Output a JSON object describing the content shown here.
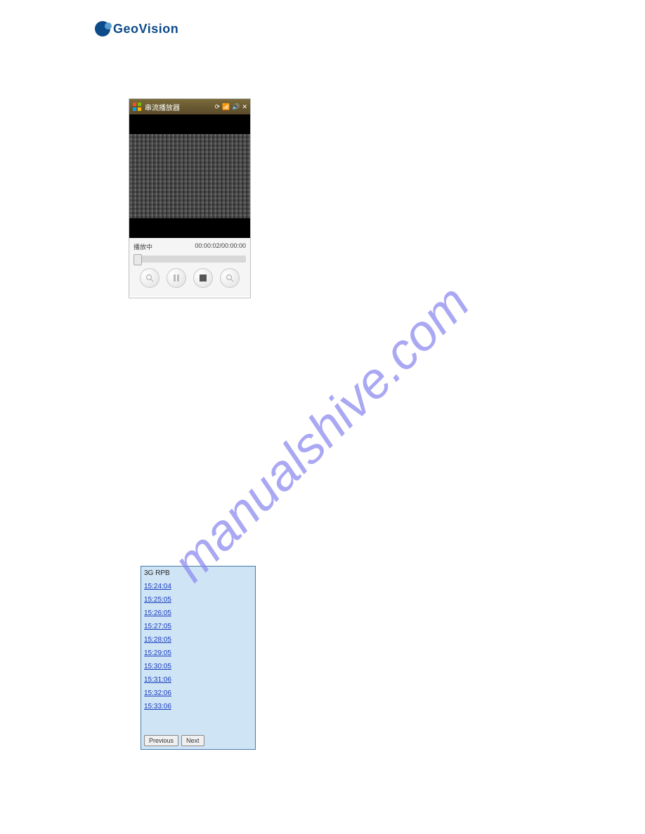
{
  "logo": {
    "text": "GeoVision"
  },
  "watermark": {
    "text": "manualshive.com",
    "color": "#8e8cf0"
  },
  "player": {
    "title": "串流播放器",
    "status_label": "播放中",
    "time_display": "00:00:02/00:00:00",
    "buttons": {
      "zoom_out": "zoom-out",
      "pause": "pause",
      "stop": "stop",
      "zoom_in": "zoom-in"
    },
    "status_icons": {
      "sync": "sync",
      "signal": "signal",
      "volume": "volume",
      "close": "close"
    }
  },
  "rpb": {
    "title": "3G RPB",
    "items": [
      "15:24:04",
      "15:25:05",
      "15:26:05",
      "15:27:05",
      "15:28:05",
      "15:29:05",
      "15:30:05",
      "15:31:06",
      "15:32:06",
      "15:33:06"
    ],
    "prev_label": "Previous",
    "next_label": "Next"
  }
}
